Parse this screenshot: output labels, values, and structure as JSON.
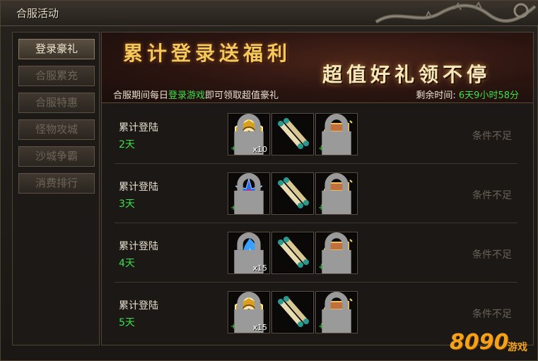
{
  "window": {
    "title": "合服活动"
  },
  "sidebar": {
    "items": [
      {
        "label": "登录豪礼",
        "active": true
      },
      {
        "label": "合服累充",
        "active": false
      },
      {
        "label": "合服特惠",
        "active": false
      },
      {
        "label": "怪物攻城",
        "active": false
      },
      {
        "label": "沙城争霸",
        "active": false
      },
      {
        "label": "消费排行",
        "active": false
      }
    ]
  },
  "banner": {
    "title": "累计登录送福利",
    "subtitle": "超值好礼领不停",
    "info_prefix": "合服期间每日",
    "info_highlight": "登录游戏",
    "info_suffix": "即可领取超值豪礼",
    "timer_label": "剩余时间:",
    "timer_value": "6天9小时58分"
  },
  "rewards": [
    {
      "label": "累计登陆",
      "days": "2天",
      "status": "条件不足",
      "items": [
        {
          "icon": "gold-token-icon",
          "qty": "x10"
        },
        {
          "icon": "scroll-icon",
          "qty": ""
        },
        {
          "icon": "treasure-chest-icon",
          "qty": ""
        }
      ]
    },
    {
      "label": "累计登陆",
      "days": "3天",
      "status": "条件不足",
      "items": [
        {
          "icon": "blue-gem-icon",
          "qty": ""
        },
        {
          "icon": "scroll-icon",
          "qty": ""
        },
        {
          "icon": "treasure-chest-icon",
          "qty": ""
        }
      ]
    },
    {
      "label": "累计登陆",
      "days": "4天",
      "status": "条件不足",
      "items": [
        {
          "icon": "blue-flame-icon",
          "qty": "x15"
        },
        {
          "icon": "scroll-icon",
          "qty": ""
        },
        {
          "icon": "treasure-chest-icon",
          "qty": ""
        }
      ]
    },
    {
      "label": "累计登陆",
      "days": "5天",
      "status": "条件不足",
      "items": [
        {
          "icon": "gold-token-icon",
          "qty": "x15"
        },
        {
          "icon": "scroll-icon",
          "qty": ""
        },
        {
          "icon": "treasure-chest-icon",
          "qty": ""
        }
      ]
    }
  ],
  "watermark": {
    "number": "8090",
    "text": "游戏"
  },
  "colors": {
    "highlight_green": "#3ce04a",
    "banner_gold": "#f4c85a",
    "disabled_text": "#6a6256"
  }
}
